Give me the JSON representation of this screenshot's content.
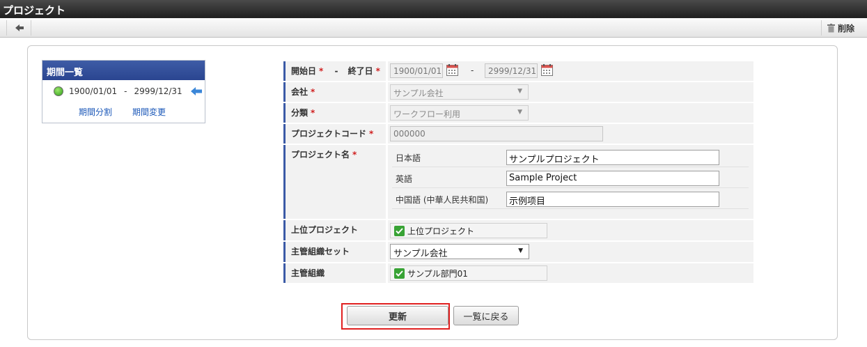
{
  "window": {
    "title": "プロジェクト"
  },
  "toolbar": {
    "delete_label": "削除"
  },
  "period_list": {
    "title": "期間一覧",
    "start": "1900/01/01",
    "separator": "-",
    "end": "2999/12/31",
    "split_link": "期間分割",
    "change_link": "期間変更"
  },
  "form": {
    "dates": {
      "start_label": "開始日",
      "separator": "-",
      "end_label": "終了日",
      "start_value": "1900/01/01",
      "range_sep": "-",
      "end_value": "2999/12/31"
    },
    "company": {
      "label": "会社",
      "value": "サンプル会社"
    },
    "category": {
      "label": "分類",
      "value": "ワークフロー利用"
    },
    "project_code": {
      "label": "プロジェクトコード",
      "value": "000000"
    },
    "project_name": {
      "label": "プロジェクト名",
      "rows": [
        {
          "lang": "日本語",
          "value": "サンプルプロジェクト"
        },
        {
          "lang": "英語",
          "value": "Sample Project"
        },
        {
          "lang": "中国語 (中華人民共和国)",
          "value": "示例项目"
        }
      ]
    },
    "parent_project": {
      "label": "上位プロジェクト",
      "value": "上位プロジェクト",
      "checked": true
    },
    "org_set": {
      "label": "主管組織セット",
      "value": "サンプル会社"
    },
    "org": {
      "label": "主管組織",
      "value": "サンプル部門01",
      "checked": true
    },
    "required_mark": "*"
  },
  "buttons": {
    "update": "更新",
    "back_to_list": "一覧に戻る"
  },
  "colors": {
    "accent": "#3b5aa6",
    "required": "#d02020",
    "highlight": "#e02020",
    "link": "#1a57b8",
    "check": "#38a335"
  }
}
